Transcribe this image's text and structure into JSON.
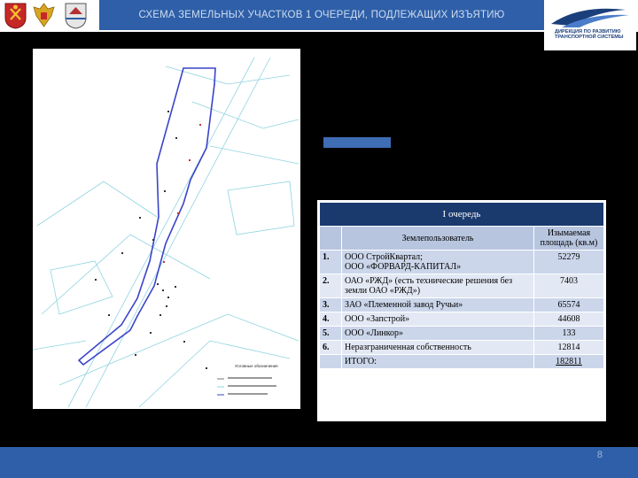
{
  "header": {
    "title": "СХЕМА ЗЕМЕЛЬНЫХ УЧАСТКОВ 1 ОЧЕРЕДИ, ПОДЛЕЖАЩИХ ИЗЪЯТИЮ"
  },
  "logo": {
    "line1": "ДИРЕКЦИЯ ПО РАЗВИТИЮ",
    "line2": "ТРАНСПОРТНОЙ СИСТЕМЫ"
  },
  "map": {
    "legend_title": "Условные обозначения"
  },
  "table": {
    "queue_title": "I очередь",
    "col_user": "Землепользователь",
    "col_area": "Изымаемая площадь (кв.м)",
    "rows": [
      {
        "num": "1.",
        "user_line1": "ООО СтройКвартал;",
        "user_line2": "ООО «ФОРВАРД-КАПИТАЛ»",
        "area": "52279"
      },
      {
        "num": "2.",
        "user_line1": "ОАО «РЖД» (есть технические решения без земли ОАО «РЖД»)",
        "user_line2": "",
        "area": "7403"
      },
      {
        "num": "3.",
        "user_line1": "ЗАО «Племенной завод Ручьи»",
        "user_line2": "",
        "area": "65574"
      },
      {
        "num": "4.",
        "user_line1": "ООО «Запстрой»",
        "user_line2": "",
        "area": "44608"
      },
      {
        "num": "5.",
        "user_line1": "ООО «Линкор»",
        "user_line2": "",
        "area": "133"
      },
      {
        "num": "6.",
        "user_line1": "Неразграниченная собственность",
        "user_line2": "",
        "area": "12814"
      }
    ],
    "total_label": "ИТОГО:",
    "total_value": "182811"
  },
  "footer": {
    "page": "8"
  },
  "colors": {
    "header_blue": "#2e5fa8",
    "table_dark": "#1a3a6e",
    "table_light": "#cbd6ea"
  }
}
